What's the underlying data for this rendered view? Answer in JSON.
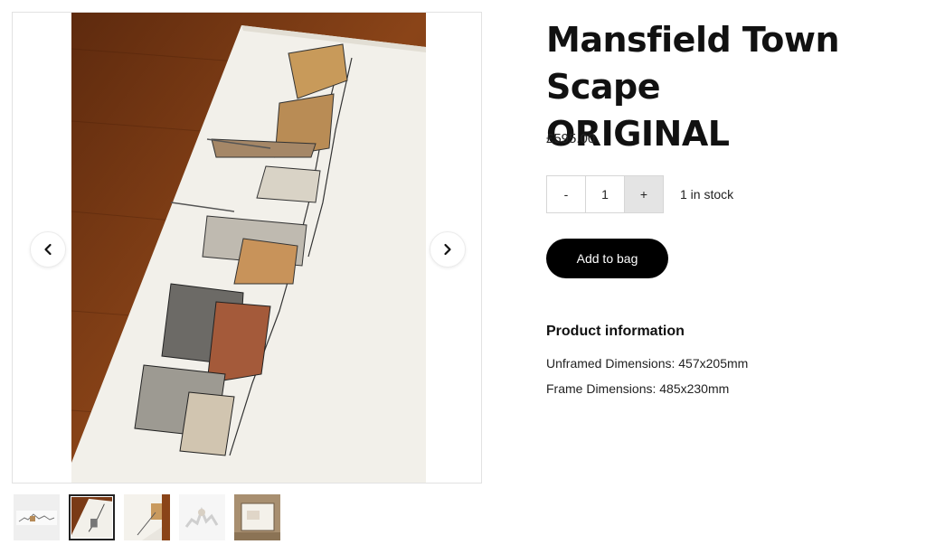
{
  "product": {
    "title_line1": "Mansfield Town Scape",
    "title_line2": "ORIGINAL",
    "price": "£595.00",
    "quantity": "1",
    "minus_label": "-",
    "plus_label": "+",
    "stock": "1 in stock",
    "add_to_bag": "Add to bag"
  },
  "info": {
    "heading": "Product information",
    "lines": [
      "Unframed Dimensions: 457x205mm",
      "Frame Dimensions: 485x230mm"
    ]
  },
  "gallery": {
    "prev_icon": "chevron-left-icon",
    "next_icon": "chevron-right-icon",
    "thumbnails": [
      "thumb-skyline-print",
      "thumb-drawing-on-table",
      "thumb-drawing-closeup",
      "thumb-blurred-print",
      "thumb-framed-print"
    ],
    "active_thumbnail": 2
  },
  "colors": {
    "button_bg": "#000000",
    "button_text": "#ffffff",
    "plus_bg": "#e4e4e4",
    "wood": "#7a3a16",
    "paper": "#f2f0ea"
  }
}
